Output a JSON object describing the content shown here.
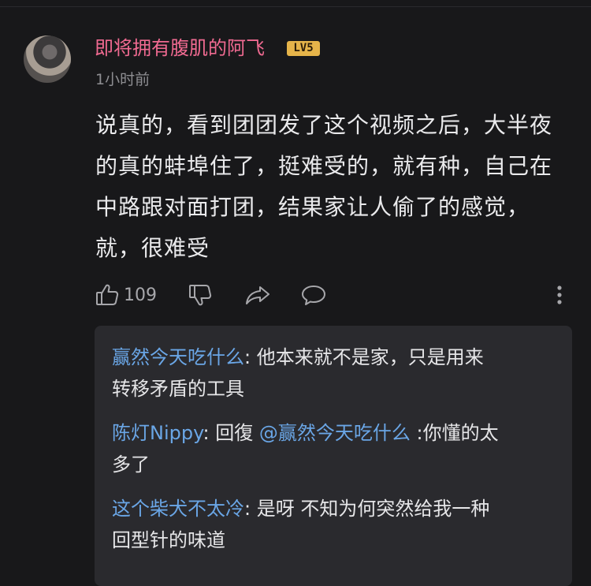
{
  "comment": {
    "username": "即将拥有腹肌的阿飞",
    "level": "LV5",
    "timestamp": "1小时前",
    "body_lines": [
      "说真的，看到团团发了这个视频之后，大半夜",
      "的真的蚌埠住了，挺难受的，就有种，自己在",
      "中路跟对面打团，结果家让人偷了的感觉，",
      "就，很难受"
    ],
    "actions": {
      "like_count": "109",
      "icons": [
        "thumbs-up-icon",
        "thumbs-down-icon",
        "share-icon",
        "comment-icon",
        "more-icon"
      ]
    }
  },
  "replies": [
    {
      "author": "赢然今天吃什么",
      "separator": ": ",
      "line1": "他本来就不是家，只是用来",
      "line2": "转移矛盾的工具"
    },
    {
      "author": "陈灯Nippy",
      "separator": ": ",
      "prefix": "回復 ",
      "mention": "@赢然今天吃什么",
      "line1": " :你懂的太",
      "line2": "多了"
    },
    {
      "author": "这个柴犬不太冷",
      "separator": ": ",
      "line1": "是呀 不知为何突然给我一种",
      "line2": "回型针的味道"
    }
  ],
  "colors": {
    "background": "#18181a",
    "username": "#f06a91",
    "reply_author": "#6aa6e6",
    "level_badge": "#e6b44a"
  }
}
